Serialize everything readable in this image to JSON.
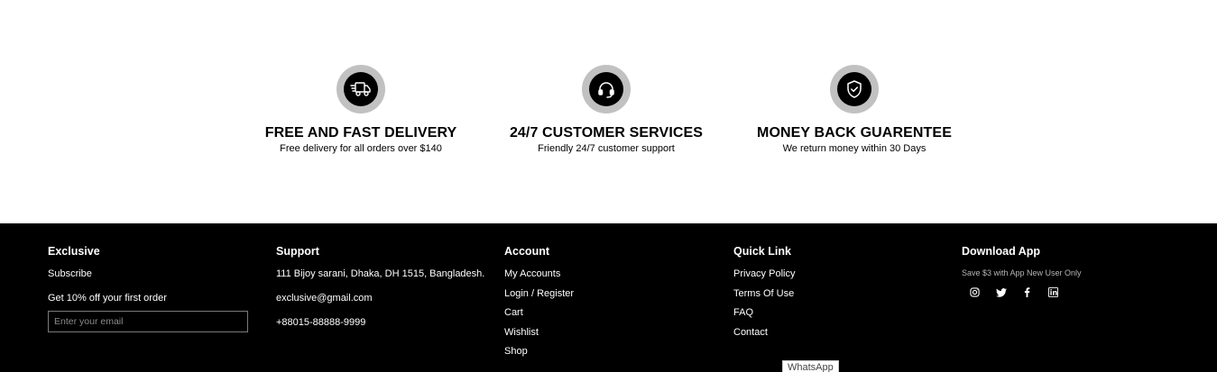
{
  "features": [
    {
      "icon": "delivery-truck-icon",
      "title": "FREE AND FAST DELIVERY",
      "desc": "Free delivery for all orders over $140"
    },
    {
      "icon": "headphones-icon",
      "title": "24/7 CUSTOMER SERVICES",
      "desc": "Friendly 24/7 customer support"
    },
    {
      "icon": "shield-check-icon",
      "title": "MONEY BACK GUARENTEE",
      "desc": "We return money within 30 Days"
    }
  ],
  "footer": {
    "exclusive": {
      "heading": "Exclusive",
      "subscribe": "Subscribe",
      "offer": "Get 10% off your first order",
      "email_placeholder": "Enter your email"
    },
    "support": {
      "heading": "Support",
      "address": "111 Bijoy sarani, Dhaka, DH 1515, Bangladesh.",
      "email": "exclusive@gmail.com",
      "phone": "+88015-88888-9999"
    },
    "account": {
      "heading": "Account",
      "links": [
        "My Accounts",
        "Login / Register",
        "Cart",
        "Wishlist",
        "Shop"
      ]
    },
    "quick_link": {
      "heading": "Quick Link",
      "links": [
        "Privacy Policy",
        "Terms Of Use",
        "FAQ",
        "Contact"
      ]
    },
    "download": {
      "heading": "Download App",
      "note": "Save $3 with App New User Only",
      "socials": [
        "instagram-icon",
        "twitter-icon",
        "facebook-icon",
        "linkedin-icon"
      ]
    }
  },
  "whatsapp_label": "WhatsApp",
  "colors": {
    "footer_bg": "#000000",
    "icon_ring": "#c1c1c1",
    "text_light": "#ffffff"
  }
}
